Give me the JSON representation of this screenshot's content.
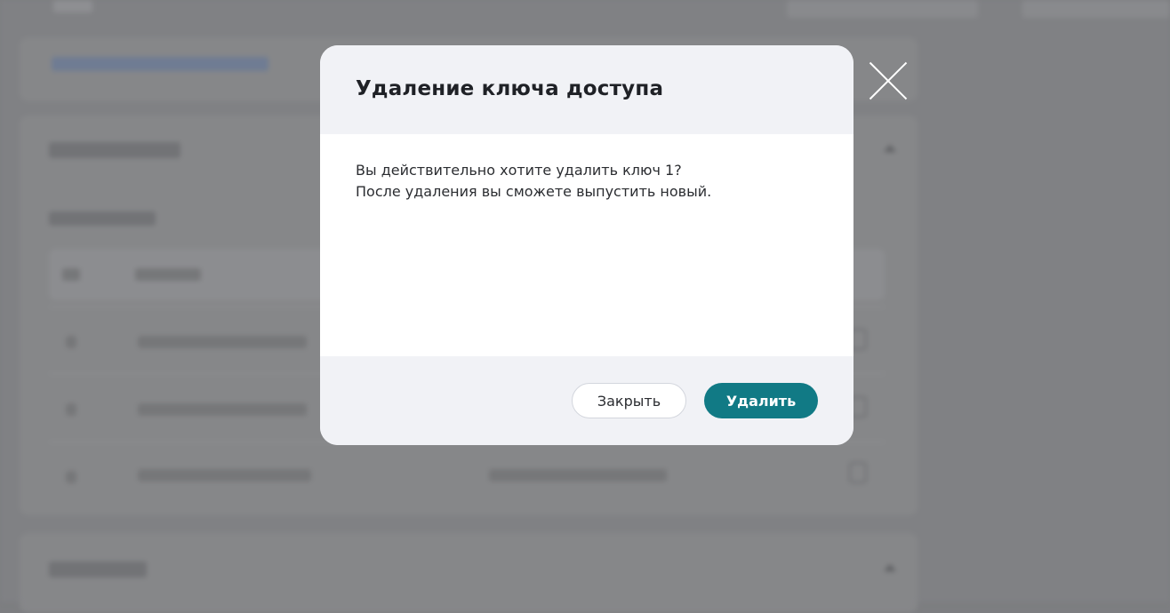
{
  "dialog": {
    "title": "Удаление ключа доступа",
    "message_line1": "Вы действительно хотите удалить ключ 1?",
    "message_line2": "После удаления вы сможете выпустить новый.",
    "close_label": "Закрыть",
    "delete_label": "Удалить"
  },
  "overlay": {
    "close_icon": "close-icon"
  },
  "colors": {
    "primary": "#117a85",
    "overlay": "#808184",
    "dialog_header": "#f1f2f6"
  }
}
